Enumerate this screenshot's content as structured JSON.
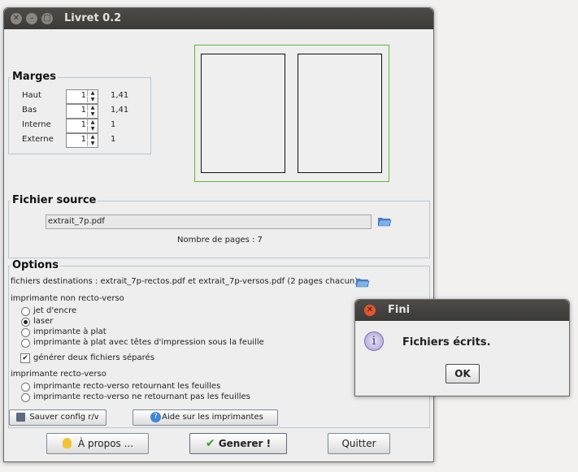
{
  "window": {
    "title": "Livret 0.2"
  },
  "margins": {
    "legend": "Marges",
    "rows": [
      {
        "label": "Haut",
        "spin": "1",
        "value": "1,41"
      },
      {
        "label": "Bas",
        "spin": "1",
        "value": "1,41"
      },
      {
        "label": "Interne",
        "spin": "1",
        "value": "1"
      },
      {
        "label": "Externe",
        "spin": "1",
        "value": "1"
      }
    ]
  },
  "source": {
    "legend": "Fichier source",
    "file": "extrait_7p.pdf",
    "pages_text": "Nombre de pages : 7"
  },
  "options": {
    "legend": "Options",
    "destinations": "fichiers destinations : extrait_7p-rectos.pdf et extrait_7p-versos.pdf (2 pages chacun)",
    "non_duplex_label": "imprimante non recto-verso",
    "non_duplex": [
      "jet d'encre",
      "laser",
      "imprimante à plat",
      "imprimante à plat avec têtes d'impression sous la feuille"
    ],
    "selected_non_duplex": 1,
    "separate_files": "générer deux fichiers séparés",
    "separate_files_checked": true,
    "duplex_label": "imprimante recto-verso",
    "duplex": [
      "imprimante recto-verso retournant les feuilles",
      "imprimante recto-verso ne retournant pas les feuilles"
    ],
    "save_config": "Sauver config r/v",
    "help_printers": "Aide sur les imprimantes"
  },
  "footer": {
    "about": "À propos ...",
    "generate": "Generer !",
    "quit": "Quitter"
  },
  "dialog": {
    "title": "Fini",
    "message": "Fichiers écrits.",
    "ok": "OK"
  },
  "colors": {
    "accent_green": "#5fb83a",
    "titlebar": "#3f3d3a",
    "close_red": "#e2562f"
  }
}
